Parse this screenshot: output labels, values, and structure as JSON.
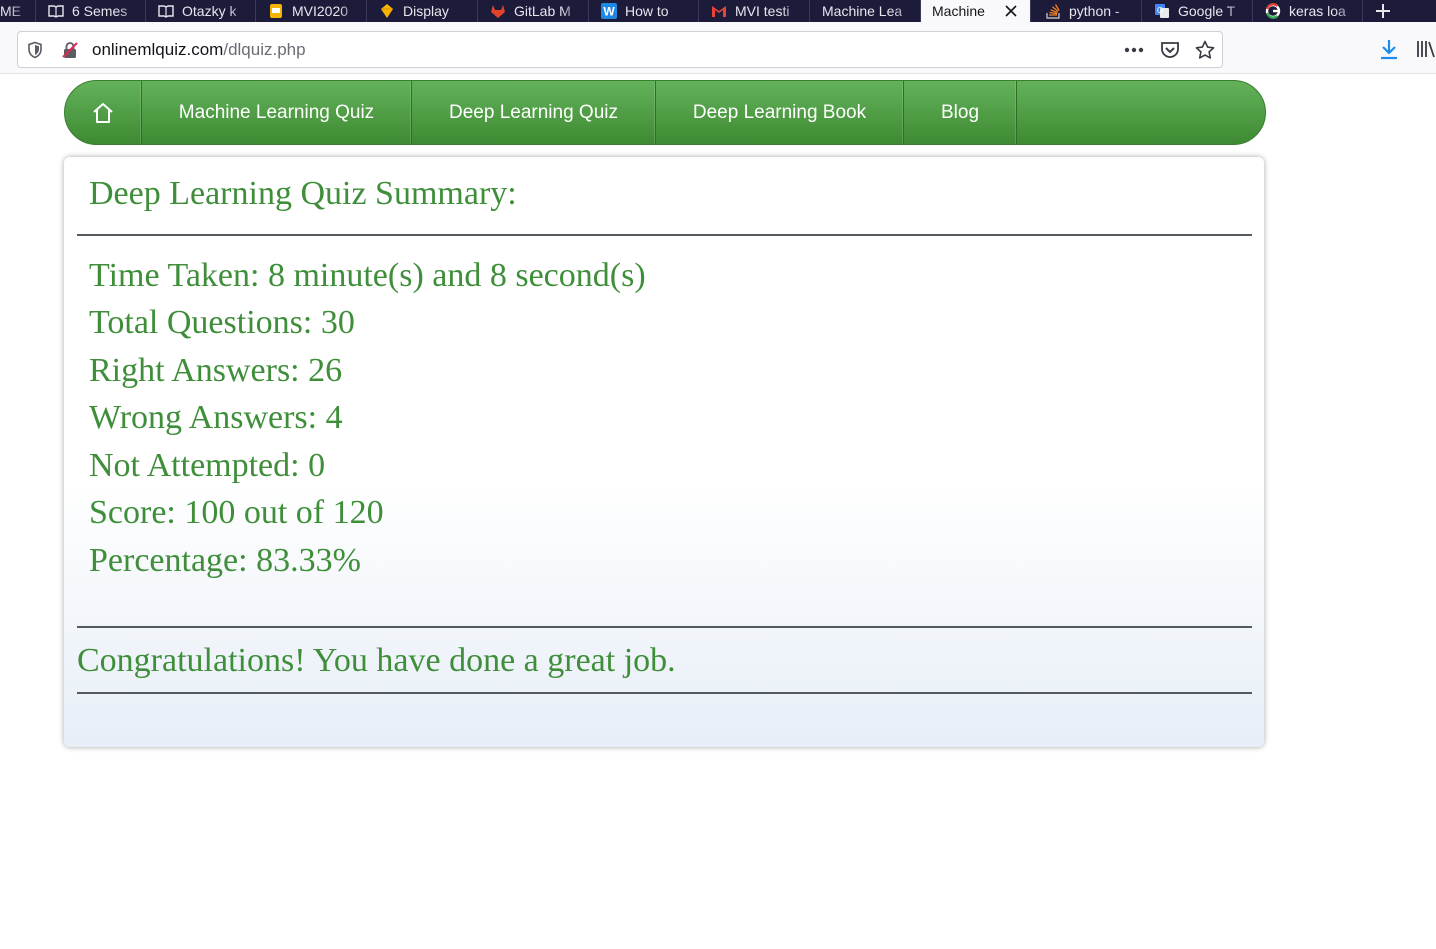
{
  "browser": {
    "tabs": [
      {
        "label": "ME",
        "icon": "",
        "active": false
      },
      {
        "label": "6 Semes",
        "icon": "book-icon",
        "active": false
      },
      {
        "label": "Otazky k",
        "icon": "book-icon",
        "active": false
      },
      {
        "label": "MVI2020",
        "icon": "slides-icon",
        "active": false
      },
      {
        "label": "Display",
        "icon": "sketch-icon",
        "active": false
      },
      {
        "label": "GitLab M",
        "icon": "gitlab-icon",
        "active": false
      },
      {
        "label": "How to",
        "icon": "w-icon",
        "active": false
      },
      {
        "label": "MVI testi",
        "icon": "gmail-icon",
        "active": false
      },
      {
        "label": "Machine Lea",
        "icon": "",
        "active": false
      },
      {
        "label": "Machine",
        "icon": "",
        "active": true
      },
      {
        "label": "python -",
        "icon": "stack-icon",
        "active": false
      },
      {
        "label": "Google T",
        "icon": "translate-icon",
        "active": false
      },
      {
        "label": "keras loa",
        "icon": "google-icon",
        "active": false
      }
    ],
    "url": {
      "domain": "onlinemlquiz.com",
      "path": "/dlquiz.php"
    }
  },
  "nav": {
    "items": [
      "Machine Learning Quiz",
      "Deep Learning Quiz",
      "Deep Learning Book",
      "Blog"
    ]
  },
  "summary": {
    "title": "Deep Learning Quiz Summary:",
    "time_taken": "Time Taken: 8 minute(s) and 8 second(s)",
    "total_questions": "Total Questions: 30",
    "right_answers": "Right Answers: 26",
    "wrong_answers": "Wrong Answers: 4",
    "not_attempted": "Not Attempted: 0",
    "score": "Score: 100 out of 120",
    "percentage": "Percentage: 83.33%",
    "message": "Congratulations! You have done a great job."
  },
  "colors": {
    "tabstrip": "#1c1b3a",
    "nav_green": "#4c9a42",
    "text_green": "#3f8e3a"
  }
}
